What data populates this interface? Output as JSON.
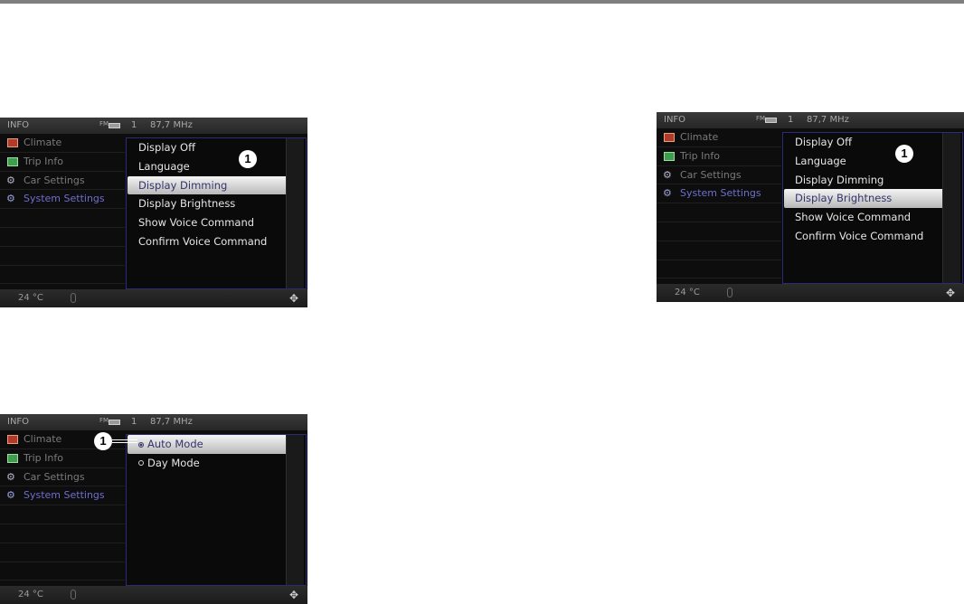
{
  "screens": [
    {
      "header": {
        "title": "INFO",
        "fm_label": "FM",
        "preset": "1",
        "frequency": "87,7 MHz"
      },
      "sidebar": [
        {
          "label": "Climate",
          "icon": "climate-icon"
        },
        {
          "label": "Trip Info",
          "icon": "trip-info-icon"
        },
        {
          "label": "Car Settings",
          "icon": "car-settings-icon"
        },
        {
          "label": "System Settings",
          "icon": "system-settings-icon",
          "selected": true
        }
      ],
      "menu": [
        "Display Off",
        "Language",
        "Display Dimming",
        "Display Brightness",
        "Show Voice Command",
        "Confirm Voice Command"
      ],
      "selected_menu": "Display Dimming",
      "callout": "1",
      "footer": {
        "temperature": "24 °C"
      }
    },
    {
      "header": {
        "title": "INFO",
        "fm_label": "FM",
        "preset": "1",
        "frequency": "87,7 MHz"
      },
      "sidebar": [
        {
          "label": "Climate",
          "icon": "climate-icon"
        },
        {
          "label": "Trip Info",
          "icon": "trip-info-icon"
        },
        {
          "label": "Car Settings",
          "icon": "car-settings-icon"
        },
        {
          "label": "System Settings",
          "icon": "system-settings-icon",
          "selected": true
        }
      ],
      "menu": [
        "Display Off",
        "Language",
        "Display Dimming",
        "Display Brightness",
        "Show Voice Command",
        "Confirm Voice Command"
      ],
      "selected_menu": "Display Brightness",
      "callout": "1",
      "footer": {
        "temperature": "24 °C"
      }
    },
    {
      "header": {
        "title": "INFO",
        "fm_label": "FM",
        "preset": "1",
        "frequency": "87,7 MHz"
      },
      "sidebar": [
        {
          "label": "Climate",
          "icon": "climate-icon"
        },
        {
          "label": "Trip Info",
          "icon": "trip-info-icon"
        },
        {
          "label": "Car Settings",
          "icon": "car-settings-icon"
        },
        {
          "label": "System Settings",
          "icon": "system-settings-icon",
          "selected": true
        }
      ],
      "menu": [
        "Auto Mode",
        "Day Mode"
      ],
      "selected_menu": "Auto Mode",
      "callout": "1",
      "footer": {
        "temperature": "24 °C"
      }
    }
  ],
  "colors": {
    "accent_selected_text": "#6e6ecf",
    "panel_border": "#2b2b78",
    "climate_icon": "#b23a2a",
    "trip_icon": "#3e9e4e"
  }
}
